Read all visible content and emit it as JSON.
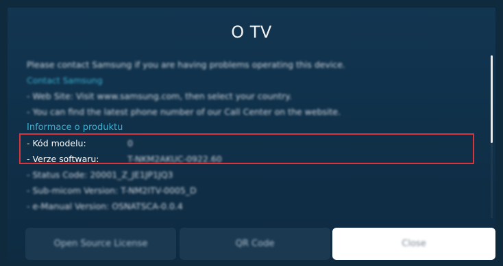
{
  "title": "O TV",
  "info": {
    "contact_text": "Please contact Samsung if you are having problems operating this device.",
    "contact_link": "Contact Samsung",
    "web_site": "- Web Site: Visit www.samsung.com, then select your country.",
    "phone": "- You can find the latest phone number of our Call Center on the website.",
    "product_heading": "Informace o produktu",
    "model_label": "- Kód modelu:",
    "model_value": "0",
    "software_label": "- Verze softwaru:",
    "software_value": "T-NKM2AKUC-0922.60",
    "status_code": "- Status Code: 20001_Z_JE1JP1JQ3",
    "sub_micom": "- Sub-micom Version: T-NM2ITV-0005_D",
    "emanual": "- e-Manual Version: OSNATSCA-0.0.4"
  },
  "buttons": {
    "open_source": "Open Source License",
    "qr_code": "QR Code",
    "close": "Close"
  }
}
